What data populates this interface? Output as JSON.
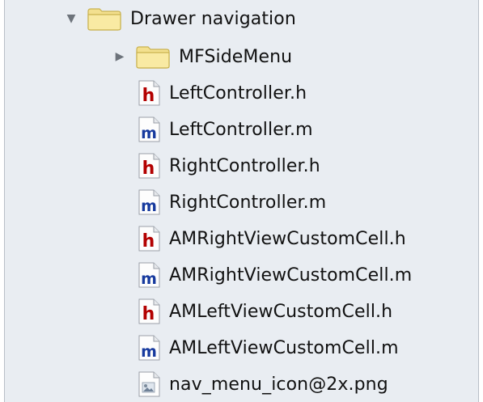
{
  "tree": {
    "root": {
      "label": "Drawer navigation",
      "expanded": true,
      "icon": "folder-icon"
    },
    "children": [
      {
        "label": "MFSideMenu",
        "type": "folder",
        "expanded": false,
        "icon": "folder-icon"
      },
      {
        "label": "LeftController.h",
        "type": "header",
        "icon": "header-file-icon",
        "badge": "h"
      },
      {
        "label": "LeftController.m",
        "type": "implementation",
        "icon": "implementation-file-icon",
        "badge": "m"
      },
      {
        "label": "RightController.h",
        "type": "header",
        "icon": "header-file-icon",
        "badge": "h"
      },
      {
        "label": "RightController.m",
        "type": "implementation",
        "icon": "implementation-file-icon",
        "badge": "m"
      },
      {
        "label": "AMRightViewCustomCell.h",
        "type": "header",
        "icon": "header-file-icon",
        "badge": "h"
      },
      {
        "label": "AMRightViewCustomCell.m",
        "type": "implementation",
        "icon": "implementation-file-icon",
        "badge": "m"
      },
      {
        "label": "AMLeftViewCustomCell.h",
        "type": "header",
        "icon": "header-file-icon",
        "badge": "h"
      },
      {
        "label": "AMLeftViewCustomCell.m",
        "type": "implementation",
        "icon": "implementation-file-icon",
        "badge": "m"
      },
      {
        "label": "nav_menu_icon@2x.png",
        "type": "image",
        "icon": "image-file-icon"
      }
    ]
  },
  "colors": {
    "header_badge": "#b30000",
    "implementation_badge": "#173a9e",
    "folder_fill": "#f6e69a",
    "panel_bg": "#e9edf2"
  }
}
